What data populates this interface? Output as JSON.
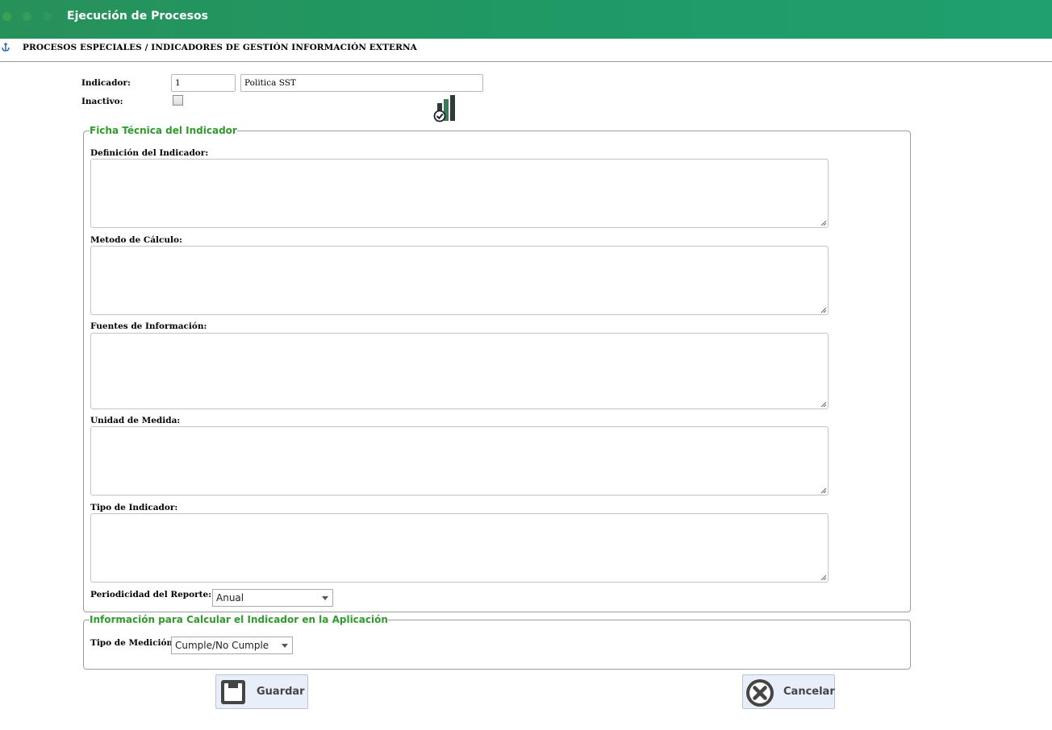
{
  "window": {
    "title": "Ejecución de Procesos"
  },
  "breadcrumb": "PROCESOS ESPECIALES / INDICADORES DE GESTIÓN INFORMACIÓN EXTERNA",
  "form": {
    "indicador_label": "Indicador:",
    "indicador_code": "1",
    "indicador_name": "Politica SST",
    "inactivo_label": "Inactivo:",
    "inactivo_checked": false
  },
  "ficha": {
    "legend": "Ficha Técnica del Indicador",
    "fields": [
      {
        "label": "Definición del Indicador:",
        "value": ""
      },
      {
        "label": "Metodo de Cálculo:",
        "value": ""
      },
      {
        "label": "Fuentes de Información:",
        "value": ""
      },
      {
        "label": "Unidad de Medida:",
        "value": ""
      },
      {
        "label": "Tipo de Indicador:",
        "value": ""
      }
    ],
    "periodicidad_label": "Periodicidad del Reporte:",
    "periodicidad_value": "Anual"
  },
  "calculo": {
    "legend": "Información para Calcular el Indicador en la Aplicación",
    "tipo_medicion_label": "Tipo de Medición:",
    "tipo_medicion_value": "Cumple/No Cumple"
  },
  "buttons": {
    "save": "Guardar",
    "cancel": "Cancelar"
  },
  "colors": {
    "titlebar": "#1f9a66",
    "legend_green": "#2f9b2b",
    "button_bg": "#e8eefa"
  }
}
